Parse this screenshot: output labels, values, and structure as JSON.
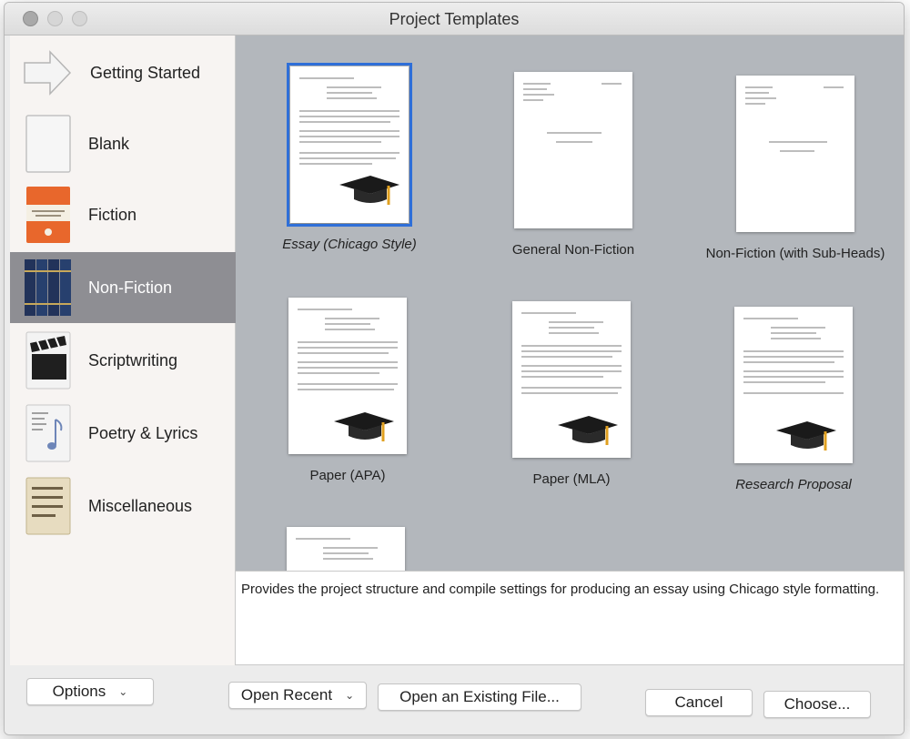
{
  "window": {
    "title": "Project Templates"
  },
  "sidebar": {
    "items": [
      {
        "label": "Getting Started",
        "icon": "arrow-icon",
        "selected": false
      },
      {
        "label": "Blank",
        "icon": "blank-page-icon",
        "selected": false
      },
      {
        "label": "Fiction",
        "icon": "paperback-book-icon",
        "selected": false
      },
      {
        "label": "Non-Fiction",
        "icon": "books-icon",
        "selected": true
      },
      {
        "label": "Scriptwriting",
        "icon": "clapperboard-icon",
        "selected": false
      },
      {
        "label": "Poetry & Lyrics",
        "icon": "music-sheet-icon",
        "selected": false
      },
      {
        "label": "Miscellaneous",
        "icon": "notecard-icon",
        "selected": false
      }
    ]
  },
  "templates": [
    {
      "label": "Essay (Chicago Style)",
      "italic": true,
      "selected": true,
      "cap": true
    },
    {
      "label": "General Non-Fiction",
      "italic": false,
      "selected": false,
      "cap": false
    },
    {
      "label": "Non-Fiction (with Sub-Heads)",
      "italic": false,
      "selected": false,
      "cap": false
    },
    {
      "label": "Paper (APA)",
      "italic": false,
      "selected": false,
      "cap": true
    },
    {
      "label": "Paper (MLA)",
      "italic": false,
      "selected": false,
      "cap": true
    },
    {
      "label": "Research Proposal",
      "italic": true,
      "selected": false,
      "cap": true
    }
  ],
  "description": "Provides the project structure and compile settings for producing an essay using Chicago style formatting.",
  "buttons": {
    "options": "Options",
    "open_recent": "Open Recent",
    "open_existing": "Open an Existing File...",
    "cancel": "Cancel",
    "choose": "Choose..."
  },
  "colors": {
    "accent": "#2f6fd8",
    "selected_sidebar": "#8e8e93",
    "grid_bg": "#b3b7bc"
  }
}
